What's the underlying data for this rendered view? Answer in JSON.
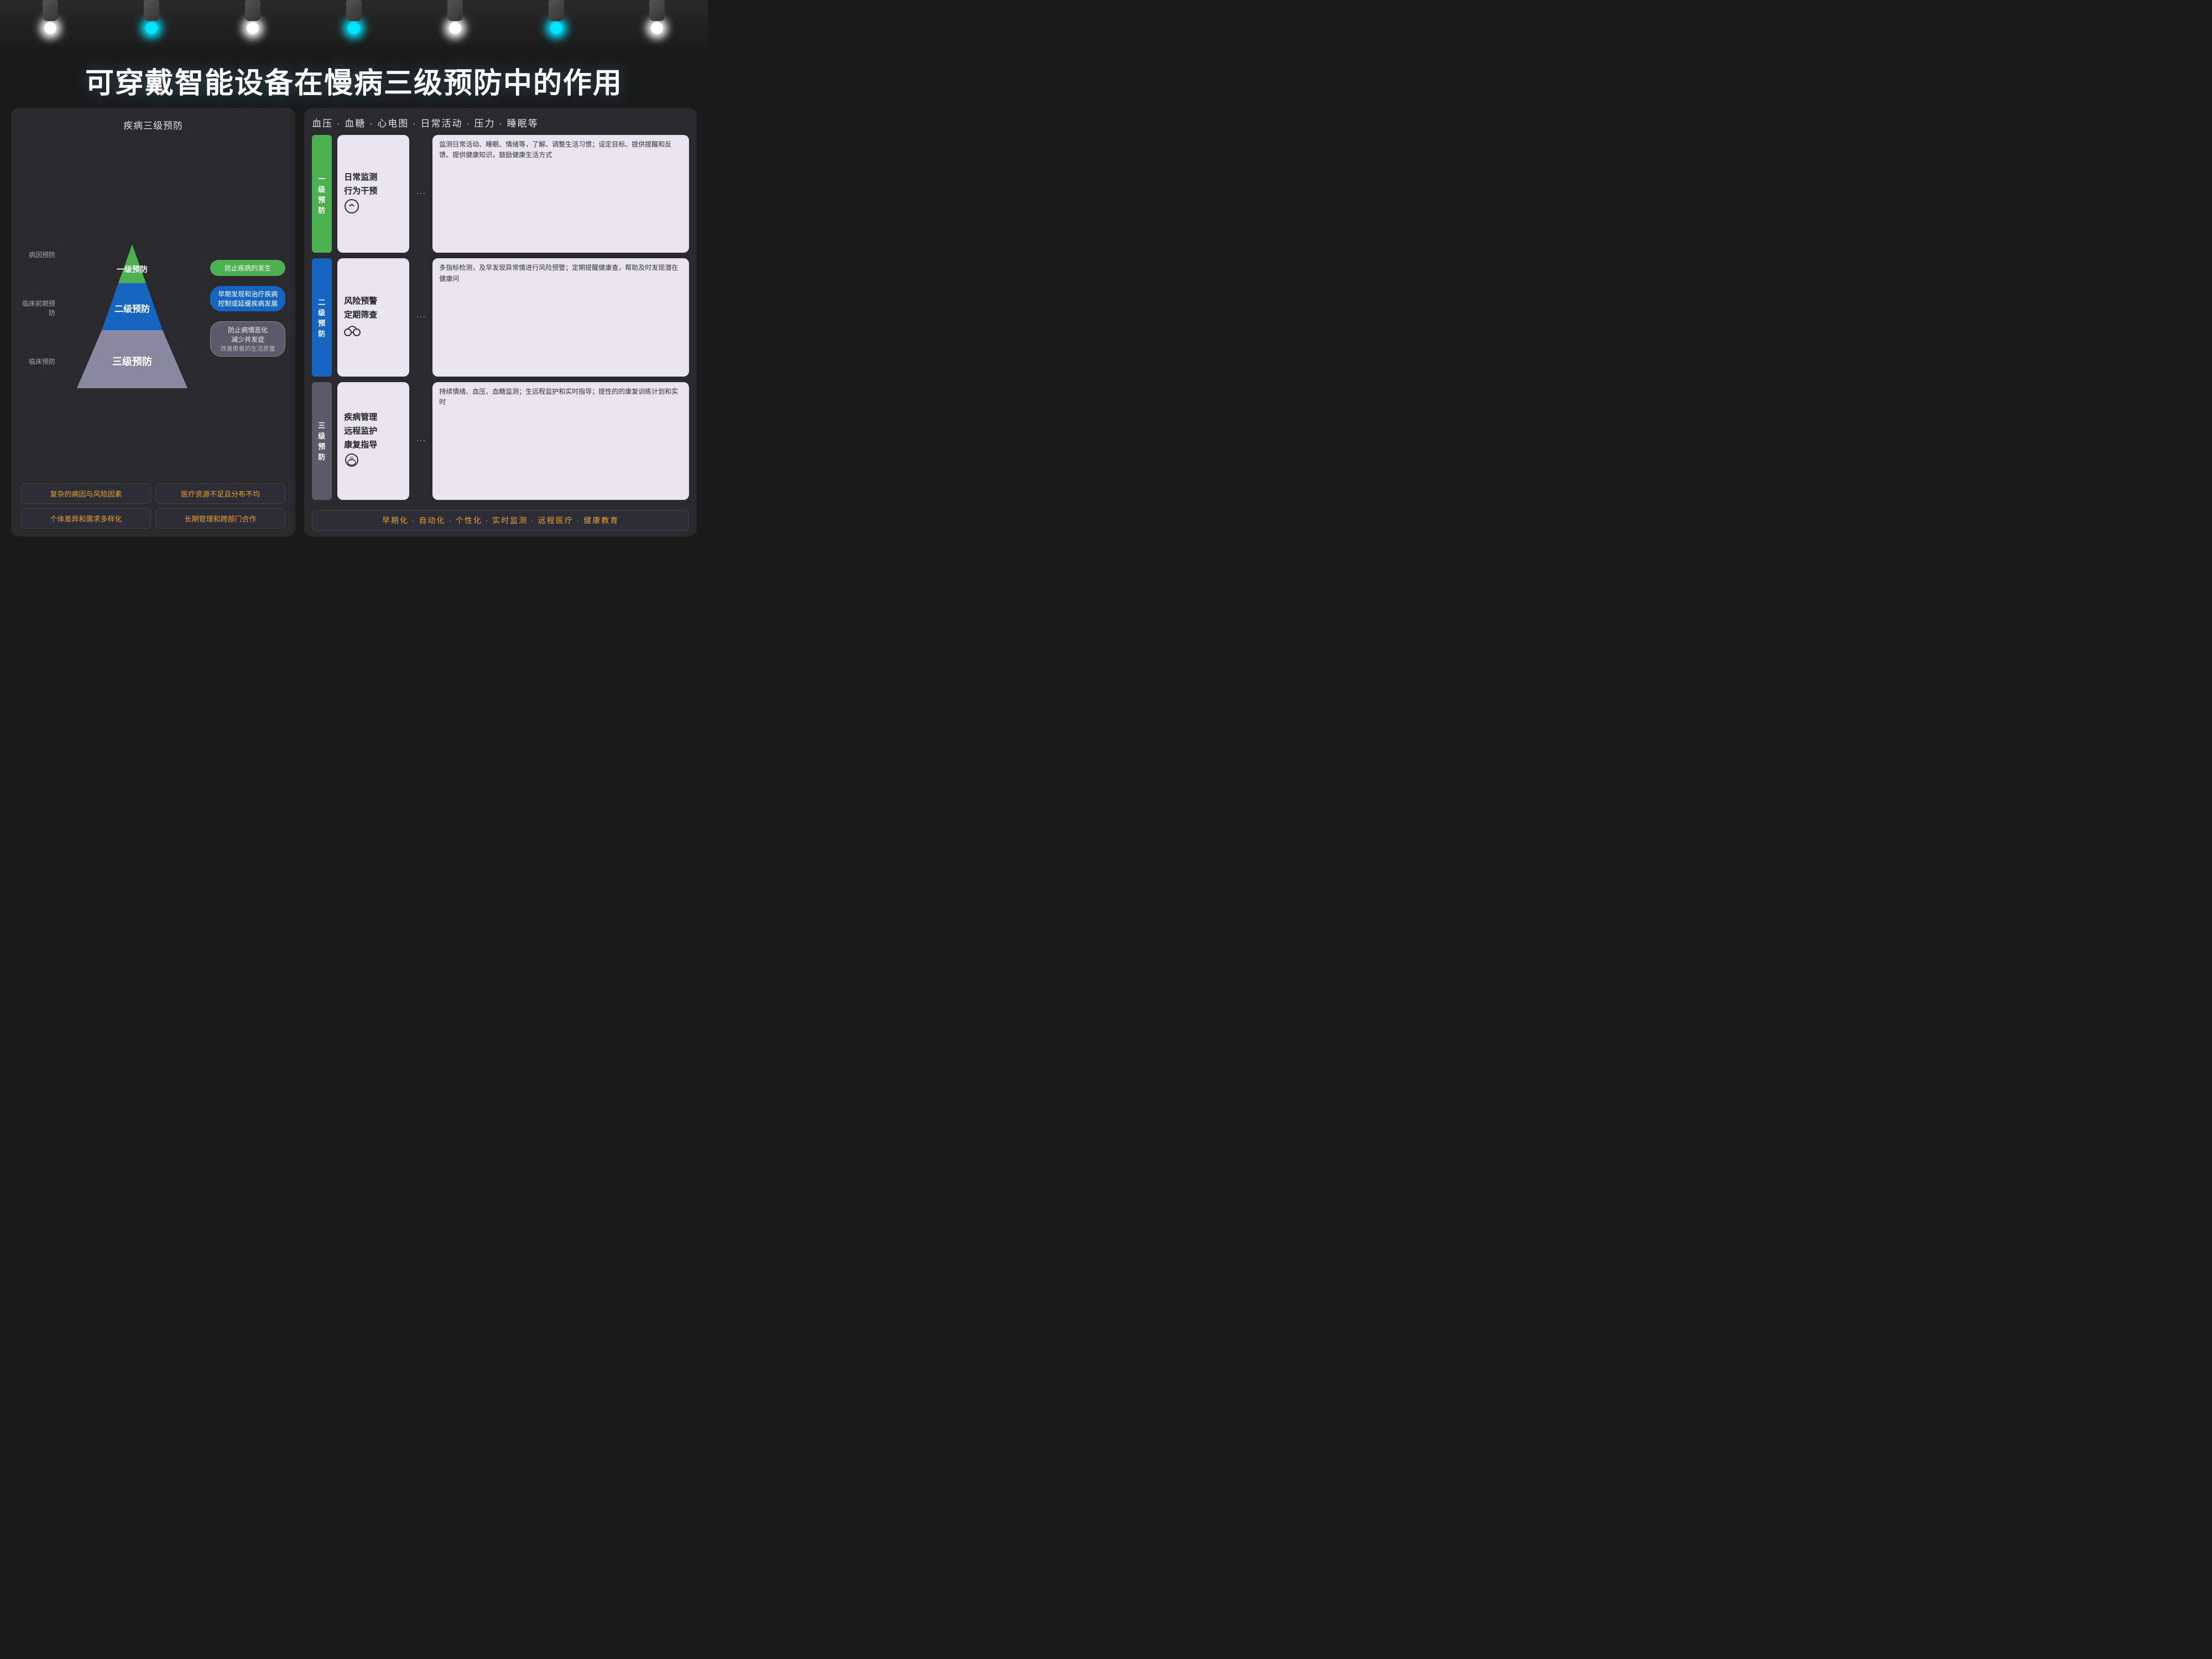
{
  "stage": {
    "lights": [
      {
        "type": "white",
        "pos": 1
      },
      {
        "type": "cyan",
        "pos": 2
      },
      {
        "type": "white",
        "pos": 3
      },
      {
        "type": "cyan",
        "pos": 4
      },
      {
        "type": "white",
        "pos": 5
      },
      {
        "type": "cyan",
        "pos": 6
      },
      {
        "type": "white",
        "pos": 7
      }
    ]
  },
  "title": "可穿戴智能设备在慢病三级预防中的作用",
  "left_panel": {
    "title": "疾病三级预防",
    "pyramid": {
      "levels": [
        {
          "text": "一级预防",
          "color": "#4caf50"
        },
        {
          "text": "二级预防",
          "color": "#1e88e5"
        },
        {
          "text": "三级预防",
          "color": "#9e9ea8"
        }
      ]
    },
    "side_labels": [
      {
        "text": "病因预防"
      },
      {
        "text": "临床前期预防"
      },
      {
        "text": "临床预防"
      }
    ],
    "right_labels": [
      {
        "text": "防止疾病的发生",
        "type": "green"
      },
      {
        "text": "早期发现和治疗疾病\n控制或延缓疾病发展",
        "type": "blue"
      },
      {
        "text": "防止病情恶化\n减少并发症\n改善患者的生活质量",
        "type": "gray"
      }
    ],
    "bottom_boxes": [
      "复杂的病因与风险因素",
      "医疗资源不足且分布不均",
      "个体差异和需求多样化",
      "长期管理和跨部门合作"
    ]
  },
  "right_panel": {
    "header": "血压 · 血糖 · 心电图 · 日常活动 · 压力 · 睡眠等",
    "levels": [
      {
        "badge_lines": [
          "一",
          "级",
          "预",
          "防"
        ],
        "badge_color": "badge-green",
        "middle_title": "日常监测\n行为干预",
        "middle_icon": "♡",
        "right_text": "监测日常活动、睡眠、情绪等，了解、调整生活习惯；设定目标、提供提醒和反馈、提供健康知识，鼓励健康生活方式"
      },
      {
        "badge_lines": [
          "二",
          "级",
          "预",
          "防"
        ],
        "badge_color": "badge-blue",
        "middle_title": "风险预警\n定期筛查",
        "middle_icon": "🎧",
        "right_text": "多指标检测，及早发现异常情进行风险预警；定期提醒健康查，帮助及时发现潜在健康问"
      },
      {
        "badge_lines": [
          "三",
          "级",
          "预",
          "防"
        ],
        "badge_color": "badge-gray",
        "middle_title": "疾病管理\n远程监护\n康复指导",
        "middle_icon": "◉",
        "right_text": "持续情绪、血压、血糖监测；生远程监护和实时指导；提性的的康复训练计划和实时"
      }
    ],
    "bottom_bar": "早期化 · 自动化 · 个性化 · 实时监测 · 远程医疗 · 健康教育"
  }
}
